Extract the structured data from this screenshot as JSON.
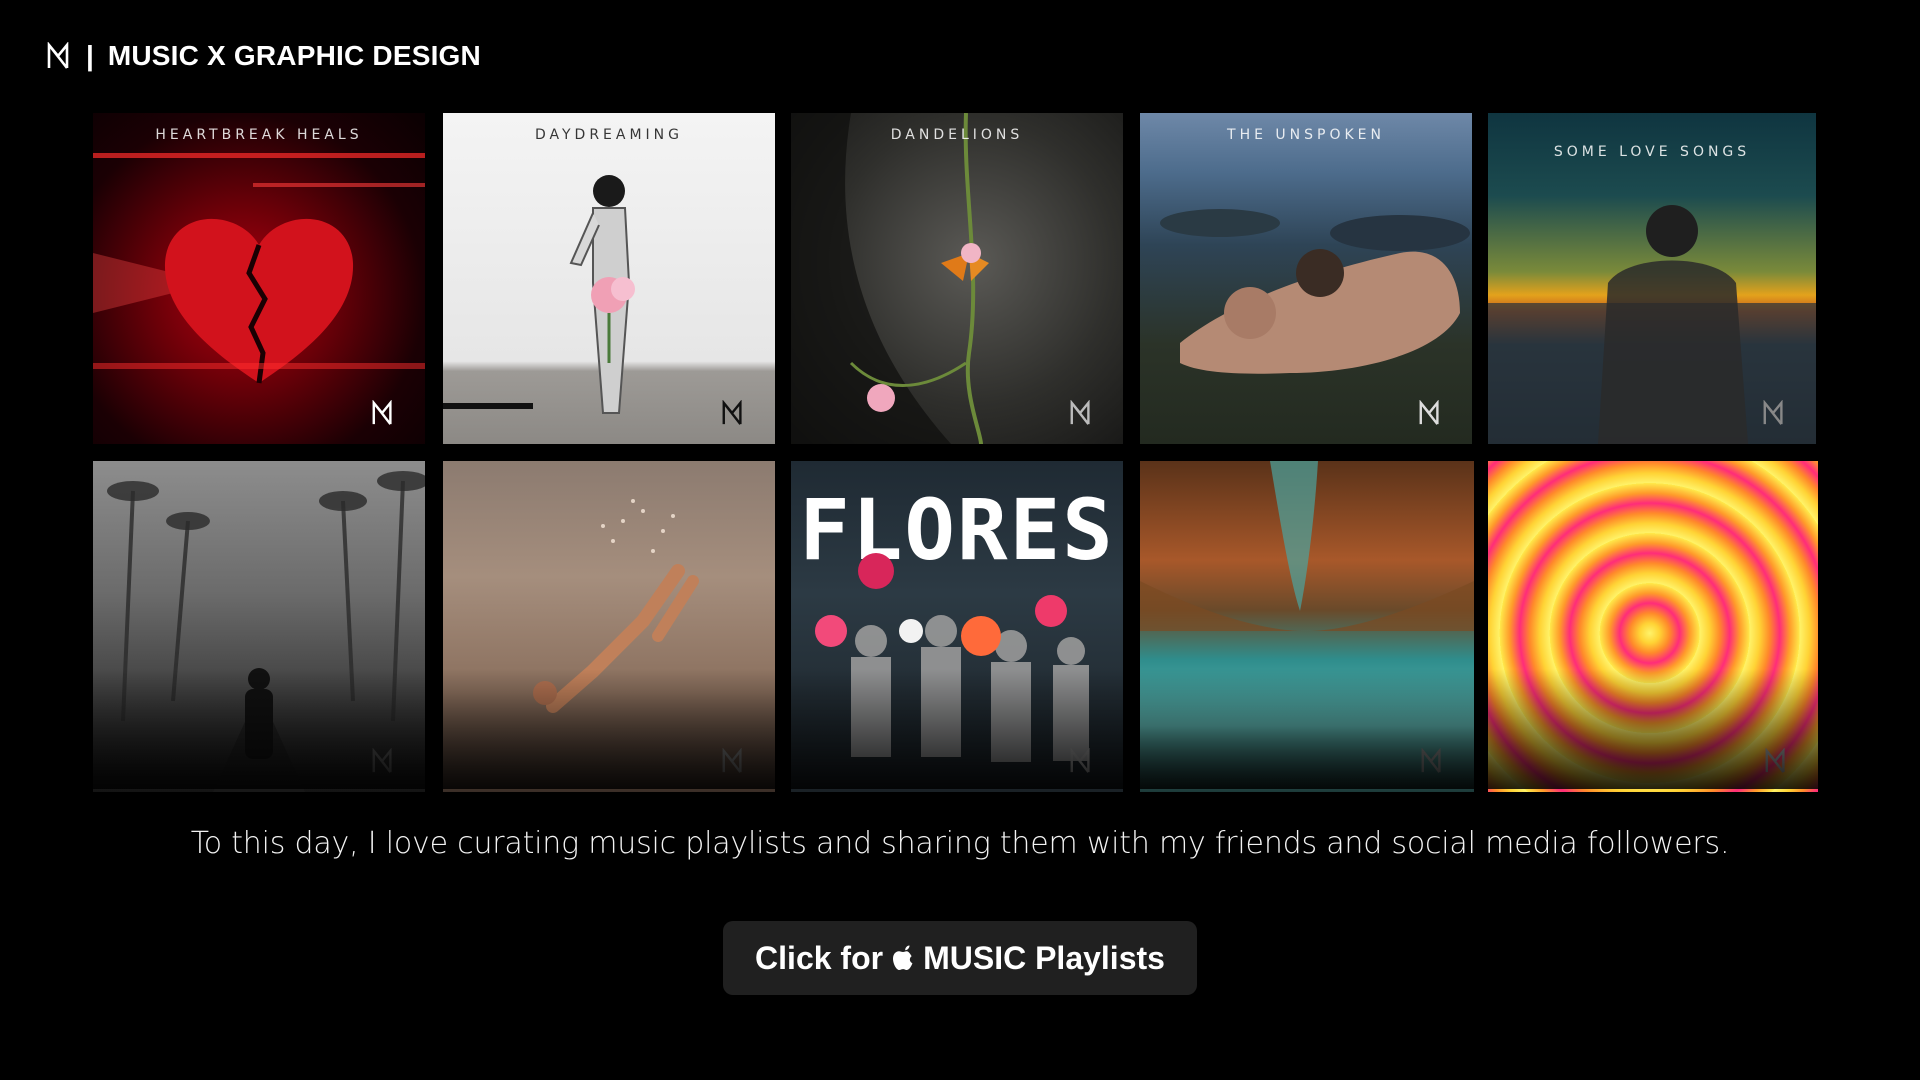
{
  "header": {
    "title": "MUSIC X GRAPHIC DESIGN",
    "separator": "|",
    "logo_icon": "nm-monogram-icon"
  },
  "playlists": [
    {
      "title": "HEARTBREAK HEALS"
    },
    {
      "title": "DAYDREAMING"
    },
    {
      "title": "DANDELIONS"
    },
    {
      "title": "THE UNSPOKEN"
    },
    {
      "title": "SOME LOVE SONGS"
    },
    {
      "title": ""
    },
    {
      "title": ""
    },
    {
      "title": "FLORES"
    },
    {
      "title": ""
    },
    {
      "title": ""
    }
  ],
  "tagline": "To this day, I love curating music playlists and sharing them with my friends and social media followers.",
  "cta": {
    "prefix": "Click for",
    "icon": "apple-icon",
    "suffix": "MUSIC Playlists"
  },
  "colors": {
    "background": "#000000",
    "button_bg": "#202020",
    "text": "#ffffff"
  }
}
